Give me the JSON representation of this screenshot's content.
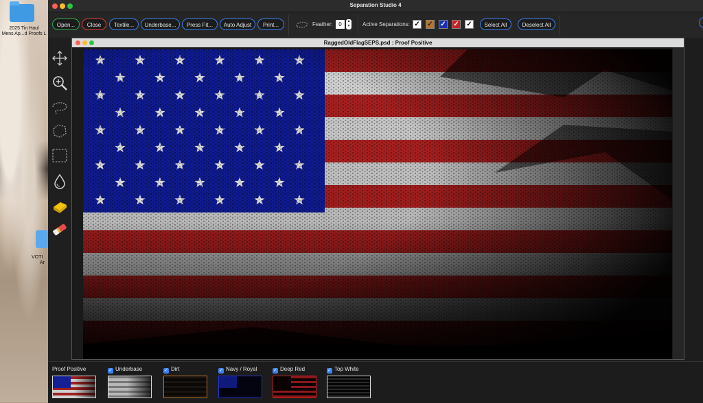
{
  "desktop": {
    "icons": [
      {
        "label_line1": "2025 Tin Haul",
        "label_line2": "Mens Ap...d Proofs L"
      },
      {
        "label_line1": "VOTI",
        "label_line2": "Ar"
      }
    ]
  },
  "app": {
    "title": "Separation Studio 4",
    "toolbar": {
      "buttons": {
        "open": "Open...",
        "close": "Close",
        "textile": "Textile...",
        "underbase": "Underbase...",
        "press_fit": "Press Fit...",
        "auto_adjust": "Auto Adjust",
        "print": "Print..."
      },
      "feather_label": "Feather:",
      "feather_value": "0",
      "active_separations_label": "Active Separations:",
      "separation_colors": [
        "#ffffff",
        "#b8732c",
        "#1b2fb5",
        "#d01e1e",
        "#ffffff"
      ],
      "select_all": "Select All",
      "deselect_all": "Deselect All"
    },
    "tools": [
      "move-icon",
      "zoom-icon",
      "lasso-icon",
      "polygon-lasso-icon",
      "marquee-icon",
      "dropper-icon",
      "sponge-icon",
      "eraser-icon"
    ]
  },
  "document": {
    "title": "RaggedOldFlagSEPS.psd : Proof Positive"
  },
  "separations": [
    {
      "label": "Proof Positive",
      "checked": null,
      "border": "#dddddd"
    },
    {
      "label": "Underbase",
      "checked": true,
      "border": "#dddddd"
    },
    {
      "label": "Dirt",
      "checked": true,
      "border": "#b8732c"
    },
    {
      "label": "Navy / Royal",
      "checked": true,
      "border": "#2235c9"
    },
    {
      "label": "Deep Red",
      "checked": true,
      "border": "#c81c1c"
    },
    {
      "label": "Top White",
      "checked": true,
      "border": "#dddddd"
    }
  ]
}
